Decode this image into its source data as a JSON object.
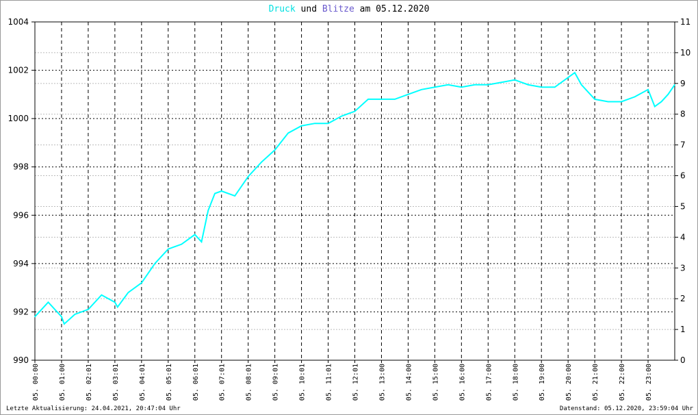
{
  "chart_data": {
    "type": "line",
    "title": {
      "part1": "Druck",
      "part2": "und",
      "part3": "Blitze",
      "part4": "am 05.12.2020"
    },
    "colors": {
      "druck": "#00ffff",
      "blitze": "#6a5acd"
    },
    "ylim": [
      990,
      1004
    ],
    "yticks": [
      "990",
      "992",
      "994",
      "996",
      "998",
      "1000",
      "1002",
      "1004"
    ],
    "y2lim": [
      0,
      11
    ],
    "y2ticks": [
      "0",
      "1",
      "2",
      "3",
      "4",
      "5",
      "6",
      "7",
      "8",
      "9",
      "10",
      "11"
    ],
    "xlim": [
      0,
      24
    ],
    "xticks": [
      "05. 00:00",
      "05. 01:00",
      "05. 02:01",
      "05. 03:01",
      "05. 04:01",
      "05. 05:01",
      "05. 06:01",
      "05. 07:01",
      "05. 08:01",
      "05. 09:01",
      "05. 10:01",
      "05. 11:01",
      "05. 12:01",
      "05. 13:00",
      "05. 14:00",
      "05. 15:00",
      "05. 16:00",
      "05. 17:00",
      "05. 18:00",
      "05. 19:00",
      "05. 20:00",
      "05. 21:00",
      "05. 22:00",
      "05. 23:00"
    ],
    "series": [
      {
        "name": "Druck",
        "x": [
          0,
          0.5,
          1,
          1.1,
          1.5,
          2,
          2.5,
          3,
          3.1,
          3.5,
          4,
          4.5,
          5,
          5.5,
          6,
          6.25,
          6.5,
          6.75,
          7,
          7.5,
          8,
          8.5,
          9,
          9.5,
          10,
          10.5,
          11,
          11.5,
          12,
          12.5,
          13,
          13.5,
          14,
          14.5,
          15,
          15.5,
          16,
          16.5,
          17,
          17.5,
          18,
          18.5,
          19,
          19.5,
          20,
          20.25,
          20.5,
          21,
          21.5,
          22,
          22.5,
          23,
          23.25,
          23.5,
          23.75,
          24
        ],
        "y": [
          991.8,
          992.4,
          991.8,
          991.5,
          991.9,
          992.1,
          992.7,
          992.4,
          992.2,
          992.8,
          993.2,
          994.0,
          994.6,
          994.8,
          995.2,
          994.9,
          996.2,
          996.9,
          997.0,
          996.8,
          997.6,
          998.2,
          998.7,
          999.4,
          999.7,
          999.8,
          999.8,
          1000.1,
          1000.3,
          1000.8,
          1000.8,
          1000.8,
          1001.0,
          1001.2,
          1001.3,
          1001.4,
          1001.3,
          1001.4,
          1001.4,
          1001.5,
          1001.6,
          1001.4,
          1001.3,
          1001.3,
          1001.7,
          1001.9,
          1001.4,
          1000.8,
          1000.7,
          1000.7,
          1000.9,
          1001.2,
          1000.5,
          1000.7,
          1001.0,
          1001.4
        ]
      }
    ]
  },
  "footer": {
    "left": "Letzte Aktualisierung: 24.04.2021, 20:47:04 Uhr",
    "right": "Datenstand: 05.12.2020, 23:59:04 Uhr"
  }
}
